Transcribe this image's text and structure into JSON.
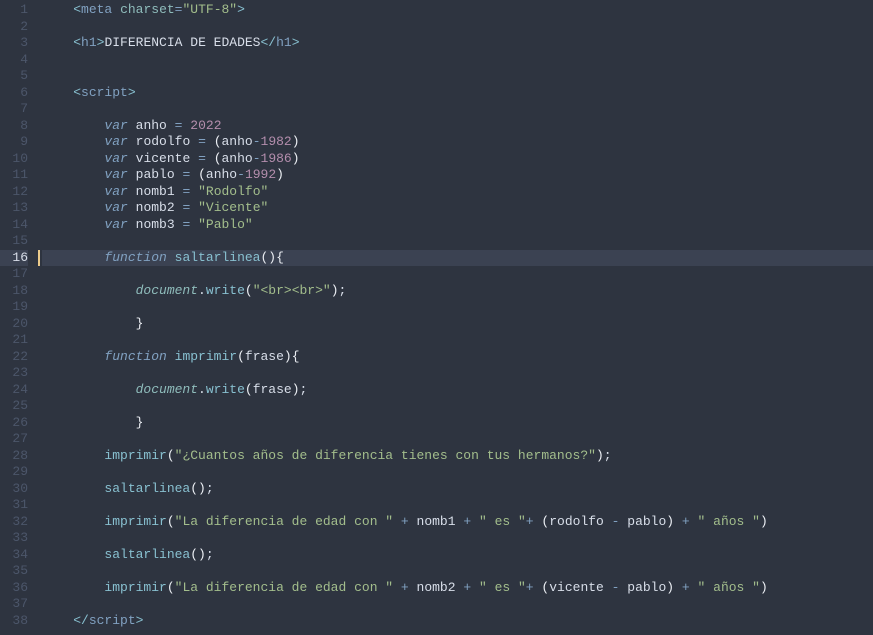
{
  "editor": {
    "activeLine": 16,
    "totalLines": 38,
    "lines": [
      {
        "n": 1,
        "tokens": [
          [
            "plain",
            "    "
          ],
          [
            "punct",
            "<"
          ],
          [
            "tag",
            "meta"
          ],
          [
            "plain",
            " "
          ],
          [
            "attr",
            "charset"
          ],
          [
            "op",
            "="
          ],
          [
            "string",
            "\"UTF-8\""
          ],
          [
            "punct",
            ">"
          ]
        ]
      },
      {
        "n": 2,
        "tokens": []
      },
      {
        "n": 3,
        "tokens": [
          [
            "plain",
            "    "
          ],
          [
            "punct",
            "<"
          ],
          [
            "tag",
            "h1"
          ],
          [
            "punct",
            ">"
          ],
          [
            "plain",
            "DIFERENCIA DE EDADES"
          ],
          [
            "punct",
            "</"
          ],
          [
            "tag",
            "h1"
          ],
          [
            "punct",
            ">"
          ]
        ]
      },
      {
        "n": 4,
        "tokens": []
      },
      {
        "n": 5,
        "tokens": []
      },
      {
        "n": 6,
        "tokens": [
          [
            "plain",
            "    "
          ],
          [
            "punct",
            "<"
          ],
          [
            "tag",
            "script"
          ],
          [
            "punct",
            ">"
          ]
        ]
      },
      {
        "n": 7,
        "tokens": []
      },
      {
        "n": 8,
        "tokens": [
          [
            "plain",
            "        "
          ],
          [
            "ikw",
            "var"
          ],
          [
            "plain",
            " "
          ],
          [
            "var",
            "anho"
          ],
          [
            "plain",
            " "
          ],
          [
            "op",
            "="
          ],
          [
            "plain",
            " "
          ],
          [
            "num",
            "2022"
          ]
        ]
      },
      {
        "n": 9,
        "tokens": [
          [
            "plain",
            "        "
          ],
          [
            "ikw",
            "var"
          ],
          [
            "plain",
            " "
          ],
          [
            "var",
            "rodolfo"
          ],
          [
            "plain",
            " "
          ],
          [
            "op",
            "="
          ],
          [
            "plain",
            " "
          ],
          [
            "paren",
            "("
          ],
          [
            "var",
            "anho"
          ],
          [
            "op",
            "-"
          ],
          [
            "num",
            "1982"
          ],
          [
            "paren",
            ")"
          ]
        ]
      },
      {
        "n": 10,
        "tokens": [
          [
            "plain",
            "        "
          ],
          [
            "ikw",
            "var"
          ],
          [
            "plain",
            " "
          ],
          [
            "var",
            "vicente"
          ],
          [
            "plain",
            " "
          ],
          [
            "op",
            "="
          ],
          [
            "plain",
            " "
          ],
          [
            "paren",
            "("
          ],
          [
            "var",
            "anho"
          ],
          [
            "op",
            "-"
          ],
          [
            "num",
            "1986"
          ],
          [
            "paren",
            ")"
          ]
        ]
      },
      {
        "n": 11,
        "tokens": [
          [
            "plain",
            "        "
          ],
          [
            "ikw",
            "var"
          ],
          [
            "plain",
            " "
          ],
          [
            "var",
            "pablo"
          ],
          [
            "plain",
            " "
          ],
          [
            "op",
            "="
          ],
          [
            "plain",
            " "
          ],
          [
            "paren",
            "("
          ],
          [
            "var",
            "anho"
          ],
          [
            "op",
            "-"
          ],
          [
            "num",
            "1992"
          ],
          [
            "paren",
            ")"
          ]
        ]
      },
      {
        "n": 12,
        "tokens": [
          [
            "plain",
            "        "
          ],
          [
            "ikw",
            "var"
          ],
          [
            "plain",
            " "
          ],
          [
            "var",
            "nomb1"
          ],
          [
            "plain",
            " "
          ],
          [
            "op",
            "="
          ],
          [
            "plain",
            " "
          ],
          [
            "string",
            "\"Rodolfo\""
          ]
        ]
      },
      {
        "n": 13,
        "tokens": [
          [
            "plain",
            "        "
          ],
          [
            "ikw",
            "var"
          ],
          [
            "plain",
            " "
          ],
          [
            "var",
            "nomb2"
          ],
          [
            "plain",
            " "
          ],
          [
            "op",
            "="
          ],
          [
            "plain",
            " "
          ],
          [
            "string",
            "\"Vicente\""
          ]
        ]
      },
      {
        "n": 14,
        "tokens": [
          [
            "plain",
            "        "
          ],
          [
            "ikw",
            "var"
          ],
          [
            "plain",
            " "
          ],
          [
            "var",
            "nomb3"
          ],
          [
            "plain",
            " "
          ],
          [
            "op",
            "="
          ],
          [
            "plain",
            " "
          ],
          [
            "string",
            "\"Pablo\""
          ]
        ]
      },
      {
        "n": 15,
        "tokens": []
      },
      {
        "n": 16,
        "tokens": [
          [
            "plain",
            "        "
          ],
          [
            "ikw",
            "function"
          ],
          [
            "plain",
            " "
          ],
          [
            "func",
            "saltarlinea"
          ],
          [
            "paren",
            "()"
          ],
          [
            "brace",
            "{"
          ]
        ]
      },
      {
        "n": 17,
        "tokens": []
      },
      {
        "n": 18,
        "tokens": [
          [
            "plain",
            "            "
          ],
          [
            "obj",
            "document"
          ],
          [
            "plain",
            "."
          ],
          [
            "func",
            "write"
          ],
          [
            "paren",
            "("
          ],
          [
            "string",
            "\"<br><br>\""
          ],
          [
            "paren",
            ")"
          ],
          [
            "plain",
            ";"
          ]
        ]
      },
      {
        "n": 19,
        "tokens": []
      },
      {
        "n": 20,
        "tokens": [
          [
            "plain",
            "            "
          ],
          [
            "brace",
            "}"
          ]
        ]
      },
      {
        "n": 21,
        "tokens": []
      },
      {
        "n": 22,
        "tokens": [
          [
            "plain",
            "        "
          ],
          [
            "ikw",
            "function"
          ],
          [
            "plain",
            " "
          ],
          [
            "func",
            "imprimir"
          ],
          [
            "paren",
            "("
          ],
          [
            "var",
            "frase"
          ],
          [
            "paren",
            ")"
          ],
          [
            "brace",
            "{"
          ]
        ]
      },
      {
        "n": 23,
        "tokens": []
      },
      {
        "n": 24,
        "tokens": [
          [
            "plain",
            "            "
          ],
          [
            "obj",
            "document"
          ],
          [
            "plain",
            "."
          ],
          [
            "func",
            "write"
          ],
          [
            "paren",
            "("
          ],
          [
            "var",
            "frase"
          ],
          [
            "paren",
            ")"
          ],
          [
            "plain",
            ";"
          ]
        ]
      },
      {
        "n": 25,
        "tokens": []
      },
      {
        "n": 26,
        "tokens": [
          [
            "plain",
            "            "
          ],
          [
            "brace",
            "}"
          ]
        ]
      },
      {
        "n": 27,
        "tokens": []
      },
      {
        "n": 28,
        "tokens": [
          [
            "plain",
            "        "
          ],
          [
            "func",
            "imprimir"
          ],
          [
            "paren",
            "("
          ],
          [
            "string",
            "\"¿Cuantos años de diferencia tienes con tus hermanos?\""
          ],
          [
            "paren",
            ")"
          ],
          [
            "plain",
            ";"
          ]
        ]
      },
      {
        "n": 29,
        "tokens": []
      },
      {
        "n": 30,
        "tokens": [
          [
            "plain",
            "        "
          ],
          [
            "func",
            "saltarlinea"
          ],
          [
            "paren",
            "()"
          ],
          [
            "plain",
            ";"
          ]
        ]
      },
      {
        "n": 31,
        "tokens": []
      },
      {
        "n": 32,
        "tokens": [
          [
            "plain",
            "        "
          ],
          [
            "func",
            "imprimir"
          ],
          [
            "paren",
            "("
          ],
          [
            "string",
            "\"La diferencia de edad con \""
          ],
          [
            "plain",
            " "
          ],
          [
            "op",
            "+"
          ],
          [
            "plain",
            " "
          ],
          [
            "var",
            "nomb1"
          ],
          [
            "plain",
            " "
          ],
          [
            "op",
            "+"
          ],
          [
            "plain",
            " "
          ],
          [
            "string",
            "\" es \""
          ],
          [
            "op",
            "+"
          ],
          [
            "plain",
            " "
          ],
          [
            "paren",
            "("
          ],
          [
            "var",
            "rodolfo"
          ],
          [
            "plain",
            " "
          ],
          [
            "op",
            "-"
          ],
          [
            "plain",
            " "
          ],
          [
            "var",
            "pablo"
          ],
          [
            "paren",
            ")"
          ],
          [
            "plain",
            " "
          ],
          [
            "op",
            "+"
          ],
          [
            "plain",
            " "
          ],
          [
            "string",
            "\" años \""
          ],
          [
            "paren",
            ")"
          ]
        ]
      },
      {
        "n": 33,
        "tokens": []
      },
      {
        "n": 34,
        "tokens": [
          [
            "plain",
            "        "
          ],
          [
            "func",
            "saltarlinea"
          ],
          [
            "paren",
            "()"
          ],
          [
            "plain",
            ";"
          ]
        ]
      },
      {
        "n": 35,
        "tokens": []
      },
      {
        "n": 36,
        "tokens": [
          [
            "plain",
            "        "
          ],
          [
            "func",
            "imprimir"
          ],
          [
            "paren",
            "("
          ],
          [
            "string",
            "\"La diferencia de edad con \""
          ],
          [
            "plain",
            " "
          ],
          [
            "op",
            "+"
          ],
          [
            "plain",
            " "
          ],
          [
            "var",
            "nomb2"
          ],
          [
            "plain",
            " "
          ],
          [
            "op",
            "+"
          ],
          [
            "plain",
            " "
          ],
          [
            "string",
            "\" es \""
          ],
          [
            "op",
            "+"
          ],
          [
            "plain",
            " "
          ],
          [
            "paren",
            "("
          ],
          [
            "var",
            "vicente"
          ],
          [
            "plain",
            " "
          ],
          [
            "op",
            "-"
          ],
          [
            "plain",
            " "
          ],
          [
            "var",
            "pablo"
          ],
          [
            "paren",
            ")"
          ],
          [
            "plain",
            " "
          ],
          [
            "op",
            "+"
          ],
          [
            "plain",
            " "
          ],
          [
            "string",
            "\" años \""
          ],
          [
            "paren",
            ")"
          ]
        ]
      },
      {
        "n": 37,
        "tokens": []
      },
      {
        "n": 38,
        "tokens": [
          [
            "plain",
            "    "
          ],
          [
            "punct",
            "</"
          ],
          [
            "tag",
            "script"
          ],
          [
            "punct",
            ">"
          ]
        ]
      }
    ]
  }
}
